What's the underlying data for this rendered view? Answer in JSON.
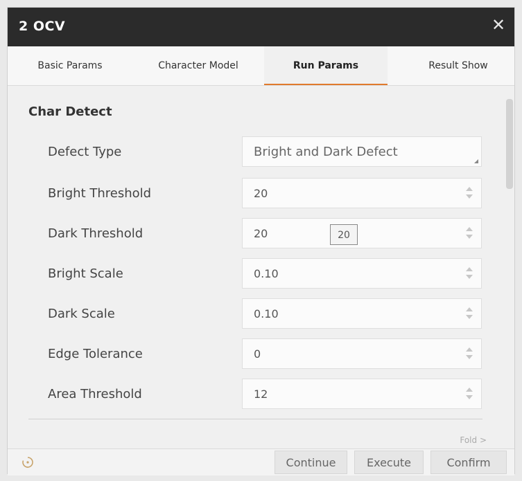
{
  "window": {
    "title": "2 OCV"
  },
  "tabs": [
    {
      "label": "Basic Params"
    },
    {
      "label": "Character Model"
    },
    {
      "label": "Run Params"
    },
    {
      "label": "Result Show"
    }
  ],
  "section": {
    "title": "Char Detect"
  },
  "rows": [
    {
      "label": "Defect Type",
      "value": "Bright and Dark Defect",
      "kind": "dropdown"
    },
    {
      "label": "Bright Threshold",
      "value": "20",
      "kind": "spinner"
    },
    {
      "label": "Dark Threshold",
      "value": "20",
      "kind": "spinner",
      "tooltip": "20"
    },
    {
      "label": "Bright Scale",
      "value": "0.10",
      "kind": "spinner"
    },
    {
      "label": "Dark Scale",
      "value": "0.10",
      "kind": "spinner"
    },
    {
      "label": "Edge Tolerance",
      "value": "0",
      "kind": "spinner"
    },
    {
      "label": "Area Threshold",
      "value": "12",
      "kind": "spinner"
    }
  ],
  "fold": {
    "label": "Fold >"
  },
  "footer": {
    "continue_label": "Continue",
    "execute_label": "Execute",
    "confirm_label": "Confirm"
  },
  "colors": {
    "accent": "#e07a2c",
    "titlebar": "#2b2b2b"
  },
  "icons": {
    "close": "close-icon",
    "reload": "reload-icon",
    "spinner": "spinner-arrows-icon",
    "dropdown": "dropdown-corner-icon"
  }
}
